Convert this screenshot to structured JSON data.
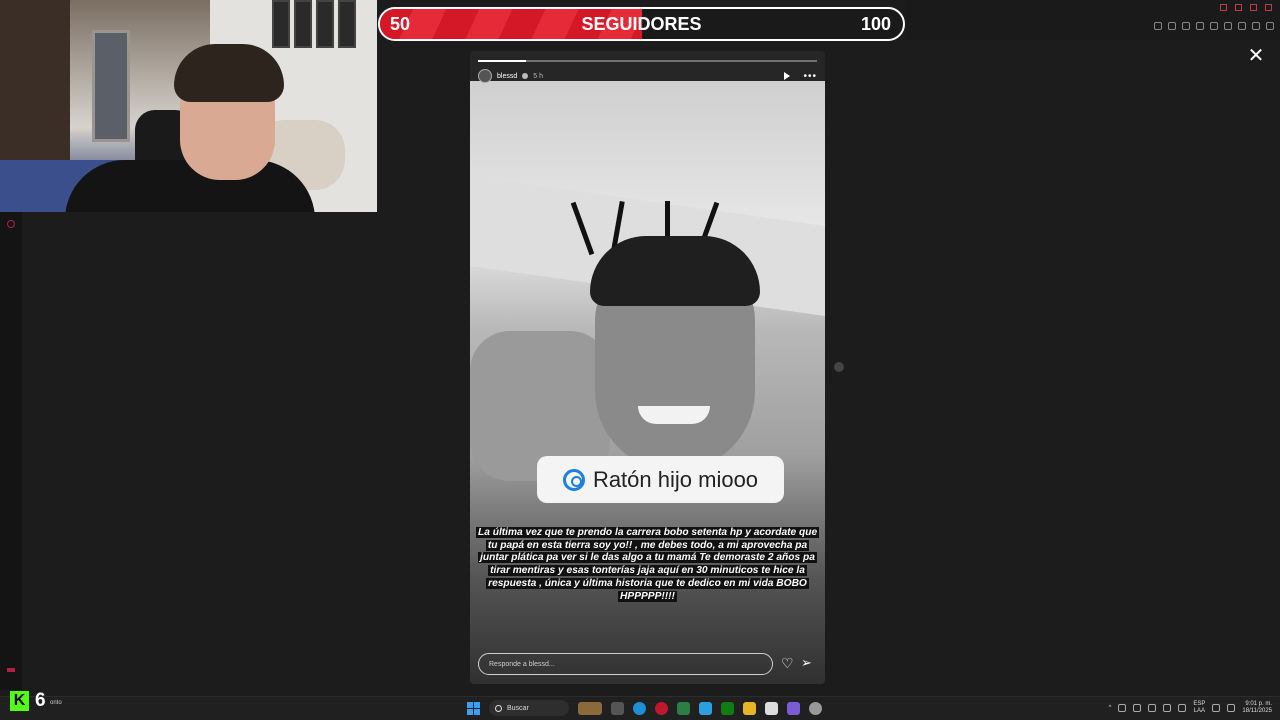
{
  "counter": {
    "start": "50",
    "title": "SEGUIDORES",
    "end": "100",
    "progress": 0.5
  },
  "story": {
    "username": "blessd",
    "time": "5 h",
    "link_text": "Ratón hijo miooo",
    "caption": "La última vez que te prendo la carrera bobo setenta hp y acordate que tu papá en esta tierra soy yo!! , me debes todo, a mi aprovecha pa juntar plática pa ver si le das algo a tu mamá  Te demoraste 2 años pa tirar mentiras y esas tonterías jaja aquí en 30 minuticos te hice la respuesta , única y última historia que te dedico en mi vida BOBO HPPPPP!!!!",
    "reply_placeholder": "Responde a blessd..."
  },
  "close_icon": "close-icon",
  "kick": {
    "logo": "K",
    "count": "6",
    "label": "onto"
  },
  "taskbar": {
    "search_label": "Buscar",
    "lang_top": "ESP",
    "lang_bottom": "LAA",
    "time": "9:01 p. m.",
    "date": "18/11/2025"
  },
  "colors": {
    "accent_red": "#e3202e",
    "kick_green": "#53fc18",
    "link_blue": "#1d7fe0"
  }
}
